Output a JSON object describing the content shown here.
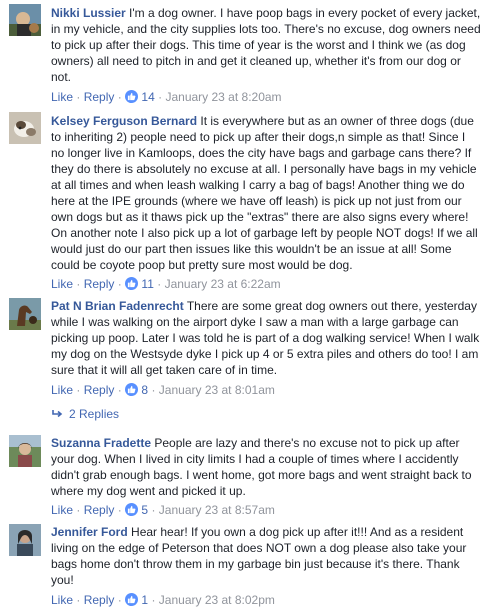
{
  "comments": [
    {
      "name": "Nikki Lussier",
      "text": "I'm a dog owner. I have poop bags in every pocket of every jacket, in my vehicle, and the city supplies lots too. There's no excuse, dog owners need to pick up after their dogs. This time of year is the worst and I think we (as dog owners) all need to pitch in and get it cleaned up, whether it's from our dog or not.",
      "like": "Like",
      "reply": "Reply",
      "reactions": "14",
      "date": "January 23 at 8:20am"
    },
    {
      "name": "Kelsey Ferguson Bernard",
      "text": "It is everywhere but as an owner of three dogs (due to inheriting 2) people need to pick up after their dogs,n simple as that! Since I no longer live in Kamloops, does the city have bags and garbage cans there? If they do there is absolutely no excuse at all. I personally have bags in my vehicle at all times and when leash walking I carry a bag of bags! Another thing we do here at the IPE grounds (where we have off leash) is pick up not just from our own dogs but as it thaws pick up the \"extras\" there are also signs every where! On another note I also pick up a lot of garbage left by people NOT dogs! If we all would just do our part then issues like this wouldn't be an issue at all! Some could be coyote poop but pretty sure most would be dog.",
      "like": "Like",
      "reply": "Reply",
      "reactions": "11",
      "date": "January 23 at 6:22am"
    },
    {
      "name": "Pat N Brian Fadenrecht",
      "text": "There are some great dog owners out there, yesterday while I was walking on the airport dyke I saw a man with a large garbage can picking up poop. Later I was told he is part of a dog walking service! When I walk my dog on the Westsyde dyke I pick up 4 or 5 extra piles and others do too! I am sure that it will all get taken care of in time.",
      "like": "Like",
      "reply": "Reply",
      "reactions": "8",
      "date": "January 23 at 8:01am"
    },
    {
      "name": "Suzanna Fradette",
      "text": "People are lazy and there's no excuse not to pick up after your dog. When I lived in city limits I had a couple of times where I accidently didn't grab enough bags. I went home, got more bags and went straight back to where my dog went and picked it up.",
      "like": "Like",
      "reply": "Reply",
      "reactions": "5",
      "date": "January 23 at 8:57am"
    },
    {
      "name": "Jennifer Ford",
      "text": "Hear hear! If you own a dog pick up after it!!! And as a resident living on the edge of Peterson that does NOT own a dog please also take your bags home don't throw them in my garbage bin just because it's there. Thank you!",
      "like": "Like",
      "reply": "Reply",
      "reactions": "1",
      "date": "January 23 at 8:02pm"
    }
  ],
  "replies_link": "2 Replies",
  "colors": {
    "name": "#365899",
    "link": "#4267b2",
    "meta": "#90949c",
    "like_badge": "#5890ff",
    "text": "#1d2129"
  }
}
